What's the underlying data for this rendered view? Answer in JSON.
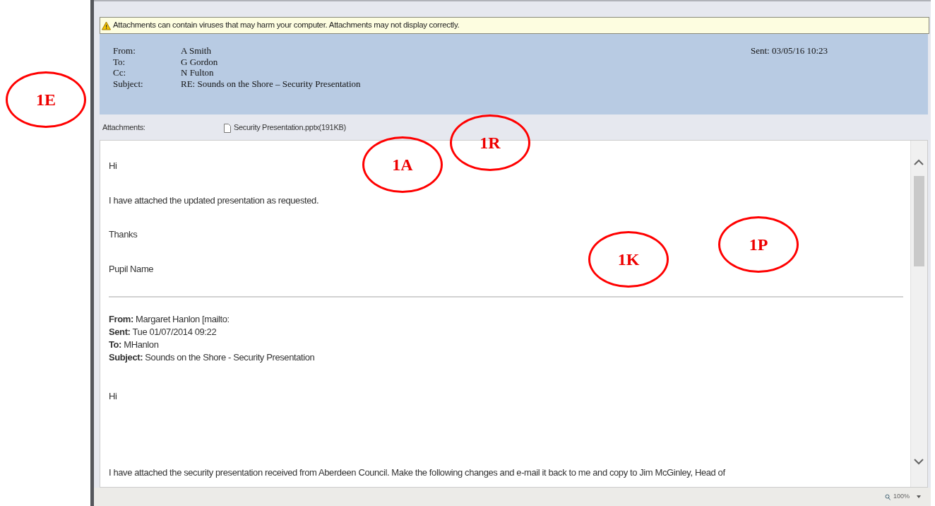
{
  "warning": "Attachments can contain viruses that may harm your computer. Attachments may not display correctly.",
  "header": {
    "fields": [
      {
        "label": "From:",
        "value": "A Smith"
      },
      {
        "label": "To:",
        "value": "G Gordon"
      },
      {
        "label": "Cc:",
        "value": "N Fulton"
      },
      {
        "label": "Subject:",
        "value": "RE: Sounds on the Shore – Security Presentation"
      }
    ],
    "sent": "Sent: 03/05/16 10:23"
  },
  "attachments": {
    "label": "Attachments:",
    "files": [
      "Security Presentation.pptx(191KB)"
    ]
  },
  "body": {
    "reply": [
      "Hi",
      "I have attached the updated presentation as requested.",
      "Thanks",
      "Pupil Name"
    ],
    "quoted_header": [
      "**From:** Margaret Hanlon [mailto:",
      "**Sent:** Tue 01/07/2014 09:22",
      "**To:** MHanlon",
      "**Subject:** Sounds on the Shore - Security Presentation"
    ],
    "quoted_body": [
      "Hi",
      "I have attached the security presentation received from Aberdeen Council. Make the following changes and e-mail it back to me and copy to Jim McGinley, Head of"
    ]
  },
  "status_bar": {
    "zoom": "100%"
  },
  "annotations": [
    {
      "label": "1E"
    },
    {
      "label": "1A"
    },
    {
      "label": "1R"
    },
    {
      "label": "1K"
    },
    {
      "label": "1P"
    }
  ]
}
